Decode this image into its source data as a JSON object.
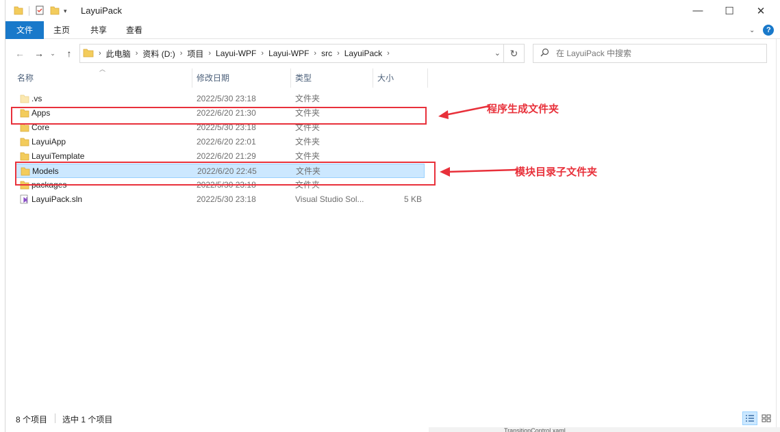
{
  "window": {
    "title": "LayuiPack",
    "controls": {
      "minimize": "—",
      "maximize": "☐",
      "close": "✕"
    }
  },
  "ribbon": {
    "tabs": [
      "文件",
      "主页",
      "共享",
      "查看"
    ],
    "help": "?"
  },
  "address": {
    "crumbs": [
      "此电脑",
      "资料 (D:)",
      "项目",
      "Layui-WPF",
      "Layui-WPF",
      "src",
      "LayuiPack"
    ]
  },
  "search": {
    "placeholder": "在 LayuiPack 中搜索"
  },
  "columns": {
    "name": "名称",
    "date": "修改日期",
    "type": "类型",
    "size": "大小"
  },
  "files": [
    {
      "name": ".vs",
      "date": "2022/5/30 23:18",
      "type": "文件夹",
      "size": "",
      "icon": "folder-icon",
      "light": true
    },
    {
      "name": "Apps",
      "date": "2022/6/20 21:30",
      "type": "文件夹",
      "size": "",
      "icon": "folder-icon"
    },
    {
      "name": "Core",
      "date": "2022/5/30 23:18",
      "type": "文件夹",
      "size": "",
      "icon": "folder-icon"
    },
    {
      "name": "LayuiApp",
      "date": "2022/6/20 22:01",
      "type": "文件夹",
      "size": "",
      "icon": "folder-icon"
    },
    {
      "name": "LayuiTemplate",
      "date": "2022/6/20 21:29",
      "type": "文件夹",
      "size": "",
      "icon": "folder-icon"
    },
    {
      "name": "Models",
      "date": "2022/6/20 22:45",
      "type": "文件夹",
      "size": "",
      "icon": "folder-icon",
      "selected": true
    },
    {
      "name": "packages",
      "date": "2022/5/30 23:18",
      "type": "文件夹",
      "size": "",
      "icon": "folder-icon"
    },
    {
      "name": "LayuiPack.sln",
      "date": "2022/5/30 23:18",
      "type": "Visual Studio Sol...",
      "size": "5 KB",
      "icon": "visual-studio-solution-icon"
    }
  ],
  "annotations": {
    "apps": "程序生成文件夹",
    "models": "模块目录子文件夹"
  },
  "status": {
    "count": "8 个项目",
    "selected": "选中 1 个项目"
  },
  "background_peek": "TransitionControl.xaml",
  "colors": {
    "accent": "#1979ca",
    "selection": "#cce8ff",
    "annotation": "#e8303a",
    "folder": "#f3cc5c"
  }
}
